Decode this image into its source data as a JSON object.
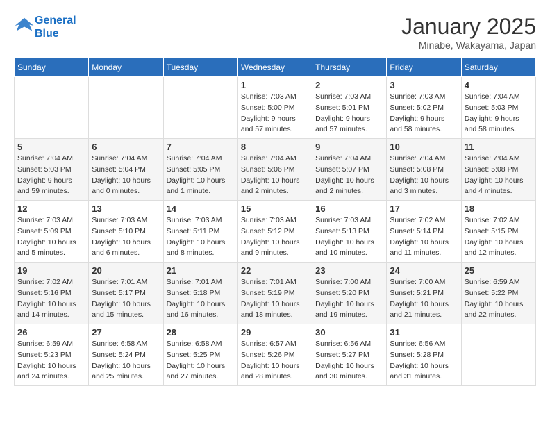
{
  "header": {
    "logo_line1": "General",
    "logo_line2": "Blue",
    "month_title": "January 2025",
    "location": "Minabe, Wakayama, Japan"
  },
  "weekdays": [
    "Sunday",
    "Monday",
    "Tuesday",
    "Wednesday",
    "Thursday",
    "Friday",
    "Saturday"
  ],
  "weeks": [
    [
      {
        "day": "",
        "info": ""
      },
      {
        "day": "",
        "info": ""
      },
      {
        "day": "",
        "info": ""
      },
      {
        "day": "1",
        "info": "Sunrise: 7:03 AM\nSunset: 5:00 PM\nDaylight: 9 hours and 57 minutes."
      },
      {
        "day": "2",
        "info": "Sunrise: 7:03 AM\nSunset: 5:01 PM\nDaylight: 9 hours and 57 minutes."
      },
      {
        "day": "3",
        "info": "Sunrise: 7:03 AM\nSunset: 5:02 PM\nDaylight: 9 hours and 58 minutes."
      },
      {
        "day": "4",
        "info": "Sunrise: 7:04 AM\nSunset: 5:03 PM\nDaylight: 9 hours and 58 minutes."
      }
    ],
    [
      {
        "day": "5",
        "info": "Sunrise: 7:04 AM\nSunset: 5:03 PM\nDaylight: 9 hours and 59 minutes."
      },
      {
        "day": "6",
        "info": "Sunrise: 7:04 AM\nSunset: 5:04 PM\nDaylight: 10 hours and 0 minutes."
      },
      {
        "day": "7",
        "info": "Sunrise: 7:04 AM\nSunset: 5:05 PM\nDaylight: 10 hours and 1 minute."
      },
      {
        "day": "8",
        "info": "Sunrise: 7:04 AM\nSunset: 5:06 PM\nDaylight: 10 hours and 2 minutes."
      },
      {
        "day": "9",
        "info": "Sunrise: 7:04 AM\nSunset: 5:07 PM\nDaylight: 10 hours and 2 minutes."
      },
      {
        "day": "10",
        "info": "Sunrise: 7:04 AM\nSunset: 5:08 PM\nDaylight: 10 hours and 3 minutes."
      },
      {
        "day": "11",
        "info": "Sunrise: 7:04 AM\nSunset: 5:08 PM\nDaylight: 10 hours and 4 minutes."
      }
    ],
    [
      {
        "day": "12",
        "info": "Sunrise: 7:03 AM\nSunset: 5:09 PM\nDaylight: 10 hours and 5 minutes."
      },
      {
        "day": "13",
        "info": "Sunrise: 7:03 AM\nSunset: 5:10 PM\nDaylight: 10 hours and 6 minutes."
      },
      {
        "day": "14",
        "info": "Sunrise: 7:03 AM\nSunset: 5:11 PM\nDaylight: 10 hours and 8 minutes."
      },
      {
        "day": "15",
        "info": "Sunrise: 7:03 AM\nSunset: 5:12 PM\nDaylight: 10 hours and 9 minutes."
      },
      {
        "day": "16",
        "info": "Sunrise: 7:03 AM\nSunset: 5:13 PM\nDaylight: 10 hours and 10 minutes."
      },
      {
        "day": "17",
        "info": "Sunrise: 7:02 AM\nSunset: 5:14 PM\nDaylight: 10 hours and 11 minutes."
      },
      {
        "day": "18",
        "info": "Sunrise: 7:02 AM\nSunset: 5:15 PM\nDaylight: 10 hours and 12 minutes."
      }
    ],
    [
      {
        "day": "19",
        "info": "Sunrise: 7:02 AM\nSunset: 5:16 PM\nDaylight: 10 hours and 14 minutes."
      },
      {
        "day": "20",
        "info": "Sunrise: 7:01 AM\nSunset: 5:17 PM\nDaylight: 10 hours and 15 minutes."
      },
      {
        "day": "21",
        "info": "Sunrise: 7:01 AM\nSunset: 5:18 PM\nDaylight: 10 hours and 16 minutes."
      },
      {
        "day": "22",
        "info": "Sunrise: 7:01 AM\nSunset: 5:19 PM\nDaylight: 10 hours and 18 minutes."
      },
      {
        "day": "23",
        "info": "Sunrise: 7:00 AM\nSunset: 5:20 PM\nDaylight: 10 hours and 19 minutes."
      },
      {
        "day": "24",
        "info": "Sunrise: 7:00 AM\nSunset: 5:21 PM\nDaylight: 10 hours and 21 minutes."
      },
      {
        "day": "25",
        "info": "Sunrise: 6:59 AM\nSunset: 5:22 PM\nDaylight: 10 hours and 22 minutes."
      }
    ],
    [
      {
        "day": "26",
        "info": "Sunrise: 6:59 AM\nSunset: 5:23 PM\nDaylight: 10 hours and 24 minutes."
      },
      {
        "day": "27",
        "info": "Sunrise: 6:58 AM\nSunset: 5:24 PM\nDaylight: 10 hours and 25 minutes."
      },
      {
        "day": "28",
        "info": "Sunrise: 6:58 AM\nSunset: 5:25 PM\nDaylight: 10 hours and 27 minutes."
      },
      {
        "day": "29",
        "info": "Sunrise: 6:57 AM\nSunset: 5:26 PM\nDaylight: 10 hours and 28 minutes."
      },
      {
        "day": "30",
        "info": "Sunrise: 6:56 AM\nSunset: 5:27 PM\nDaylight: 10 hours and 30 minutes."
      },
      {
        "day": "31",
        "info": "Sunrise: 6:56 AM\nSunset: 5:28 PM\nDaylight: 10 hours and 31 minutes."
      },
      {
        "day": "",
        "info": ""
      }
    ]
  ]
}
